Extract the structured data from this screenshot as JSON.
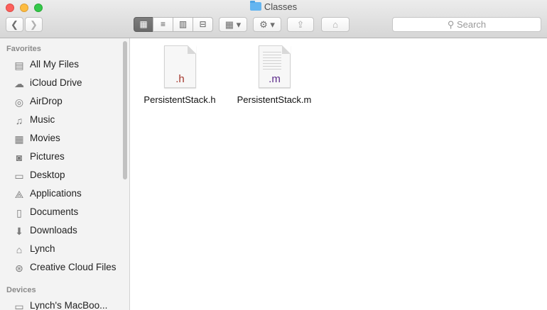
{
  "window": {
    "title": "Classes",
    "colors": {
      "close": "#fc605c",
      "minimize": "#fdbc40",
      "maximize": "#34c84a"
    }
  },
  "toolbar": {
    "back_icon": "chevron-left-icon",
    "forward_icon": "chevron-right-icon",
    "view_modes": [
      {
        "name": "icon-view",
        "glyph": "▦",
        "active": true
      },
      {
        "name": "list-view",
        "glyph": "≡",
        "active": false
      },
      {
        "name": "column-view",
        "glyph": "▥",
        "active": false
      },
      {
        "name": "cover-flow-view",
        "glyph": "⊟",
        "active": false
      }
    ],
    "arrange_glyph": "▦ ▾",
    "action_glyph": "⚙ ▾",
    "share_glyph": "⇪",
    "tag_glyph": "⌂",
    "search_placeholder": "Search",
    "search_icon": "⚲"
  },
  "sidebar": {
    "sections": [
      {
        "title": "Favorites",
        "items": [
          {
            "label": "All My Files",
            "icon": "▤"
          },
          {
            "label": "iCloud Drive",
            "icon": "☁"
          },
          {
            "label": "AirDrop",
            "icon": "◎"
          },
          {
            "label": "Music",
            "icon": "♫"
          },
          {
            "label": "Movies",
            "icon": "▦"
          },
          {
            "label": "Pictures",
            "icon": "◙"
          },
          {
            "label": "Desktop",
            "icon": "▭"
          },
          {
            "label": "Applications",
            "icon": "⟁"
          },
          {
            "label": "Documents",
            "icon": "▯"
          },
          {
            "label": "Downloads",
            "icon": "⬇"
          },
          {
            "label": "Lynch",
            "icon": "⌂"
          },
          {
            "label": "Creative Cloud Files",
            "icon": "⊛"
          }
        ]
      },
      {
        "title": "Devices",
        "items": [
          {
            "label": "Lynch's MacBoo...",
            "icon": "▭"
          }
        ]
      }
    ]
  },
  "files": [
    {
      "name": "PersistentStack.h",
      "ext": ".h",
      "ext_color": "#a3352a"
    },
    {
      "name": "PersistentStack.m",
      "ext": ".m",
      "ext_color": "#5b2a8a"
    }
  ]
}
